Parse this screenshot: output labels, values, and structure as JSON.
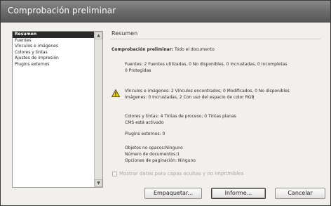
{
  "window": {
    "title": "Comprobación preliminar"
  },
  "sidebar": {
    "items": [
      {
        "label": "Resumen",
        "selected": true
      },
      {
        "label": "Fuentes"
      },
      {
        "label": "Vínculos e imágenes"
      },
      {
        "label": "Colores y tintas"
      },
      {
        "label": "Ajustes de impresión"
      },
      {
        "label": "Plugins externos"
      }
    ]
  },
  "panel": {
    "header": "Resumen",
    "preflight_label": "Comprobación preliminar:",
    "preflight_value": "Todo el documento",
    "fonts_line1": "Fuentes:  2 Fuentes utilizadas, 0 No disponibles, 0 Incrustadas, 0 Incompletas",
    "fonts_line2": "0 Protegidas",
    "links_line1": "Vínculos e imágenes:  2 Vínculos encontrados; 0 Modificados, 0 No disponibles",
    "links_line2": "Imágenes:  0 Incrustadas, 2 Con uso del espacio de color RGB",
    "colors_line1": "Colores y tintas:  4 Tintas de proceso; 0 Tintas planas",
    "colors_line2": "CMS está activado",
    "plugins": "Plugins externos: 0",
    "objects_line1": "Objetos no opacos:Ninguno",
    "objects_line2": "Número de documentos:1",
    "objects_line3": "Opciones de paginación:  Ninguno",
    "show_hidden_label": "Mostrar datos para capas ocultas y no imprimibles"
  },
  "buttons": {
    "package": "Empaquetar...",
    "report": "Informe...",
    "cancel": "Cancelar"
  },
  "colors": {
    "selection": "#2a2a2a",
    "titlebar": "#6e6e6e",
    "warning": "#f2d200"
  }
}
